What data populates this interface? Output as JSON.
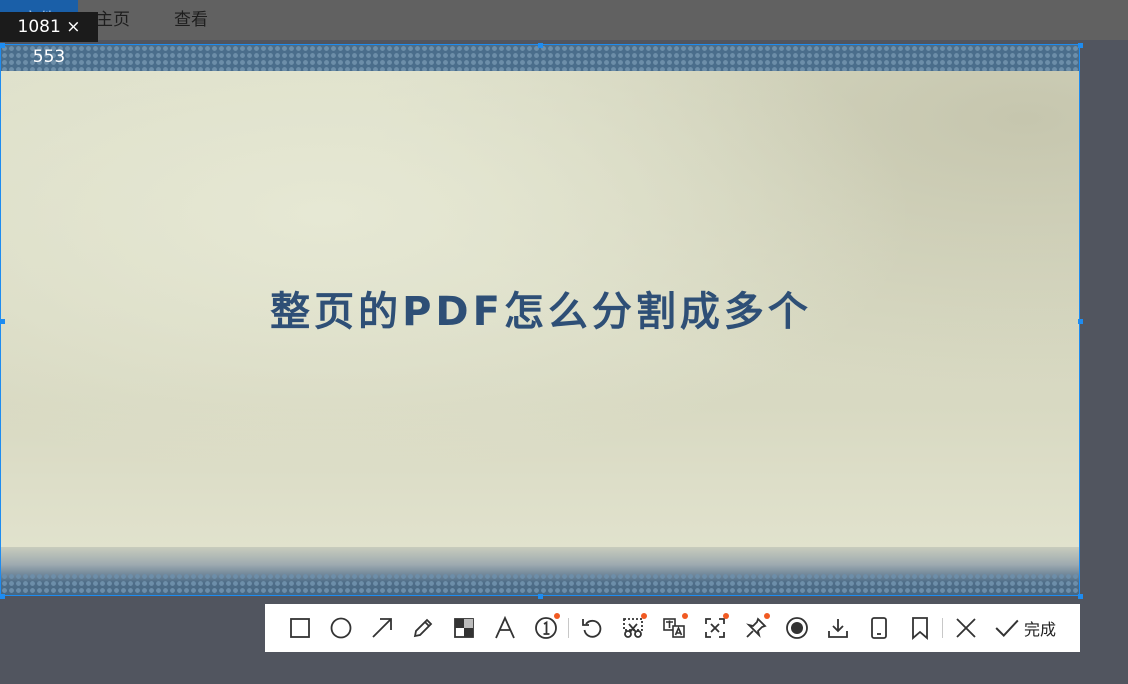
{
  "menubar": {
    "file": "文件",
    "home": "主页",
    "view": "查看"
  },
  "selection": {
    "size_readout": "1081 × 553"
  },
  "slide": {
    "title": "整页的PDF怎么分割成多个"
  },
  "toolbar": {
    "tools": [
      {
        "name": "rectangle-icon"
      },
      {
        "name": "ellipse-icon"
      },
      {
        "name": "arrow-icon"
      },
      {
        "name": "pencil-icon"
      },
      {
        "name": "mosaic-icon"
      },
      {
        "name": "text-icon"
      },
      {
        "name": "number-marker-icon"
      },
      {
        "name": "undo-icon"
      },
      {
        "name": "scissors-icon"
      },
      {
        "name": "translate-icon"
      },
      {
        "name": "ocr-icon"
      },
      {
        "name": "pin-icon"
      },
      {
        "name": "record-icon"
      },
      {
        "name": "download-icon"
      },
      {
        "name": "phone-icon"
      },
      {
        "name": "bookmark-icon"
      },
      {
        "name": "close-icon"
      },
      {
        "name": "check-icon"
      }
    ],
    "done_label": "完成"
  },
  "colors": {
    "accent": "#1e8cf0",
    "title": "#2e4f76",
    "badge": "#f15a22"
  }
}
